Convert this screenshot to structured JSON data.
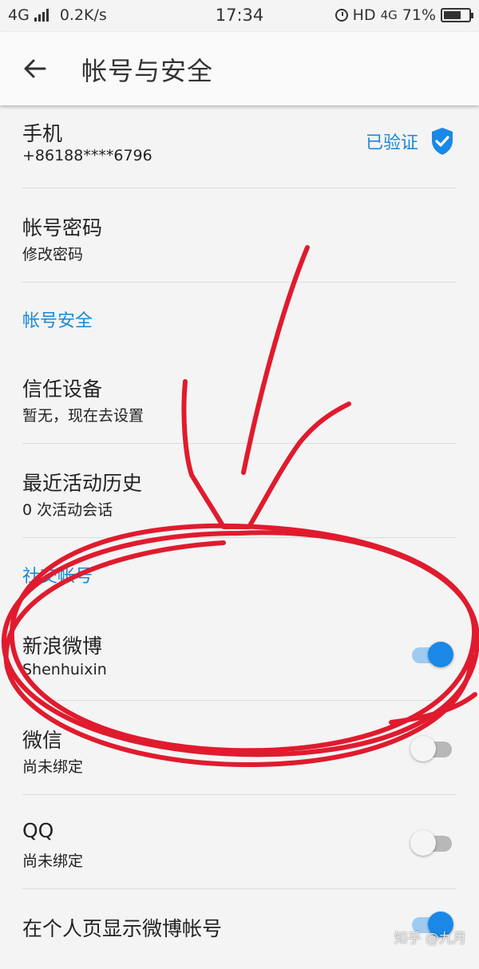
{
  "status_bar": {
    "network": "4G",
    "speed": "0.2K/s",
    "time": "17:34",
    "hd": "HD",
    "network_right": "4G",
    "battery": "71%"
  },
  "appbar": {
    "title": "帐号与安全",
    "back_icon": "arrow-left-icon"
  },
  "rows": {
    "phone": {
      "title": "手机",
      "sub": "+86188****6796",
      "badge": "已验证",
      "badge_icon": "shield-check-icon"
    },
    "password": {
      "title": "帐号密码",
      "sub": "修改密码"
    },
    "section_security": "帐号安全",
    "trusted": {
      "title": "信任设备",
      "sub": "暂无，现在去设置"
    },
    "activity": {
      "title": "最近活动历史",
      "sub": "0 次活动会话"
    },
    "section_social": "社交帐号",
    "weibo": {
      "title": "新浪微博",
      "sub": "Shenhuixin",
      "toggle": "on"
    },
    "wechat": {
      "title": "微信",
      "sub": "尚未绑定",
      "toggle": "off"
    },
    "qq": {
      "title": "QQ",
      "sub": "尚未绑定",
      "toggle": "off"
    },
    "show_weibo": {
      "title": "在个人页显示微博帐号",
      "toggle": "on"
    }
  },
  "watermark": "知乎 @九月",
  "colors": {
    "accent": "#1a88e6",
    "annotation": "#e01b2e"
  }
}
